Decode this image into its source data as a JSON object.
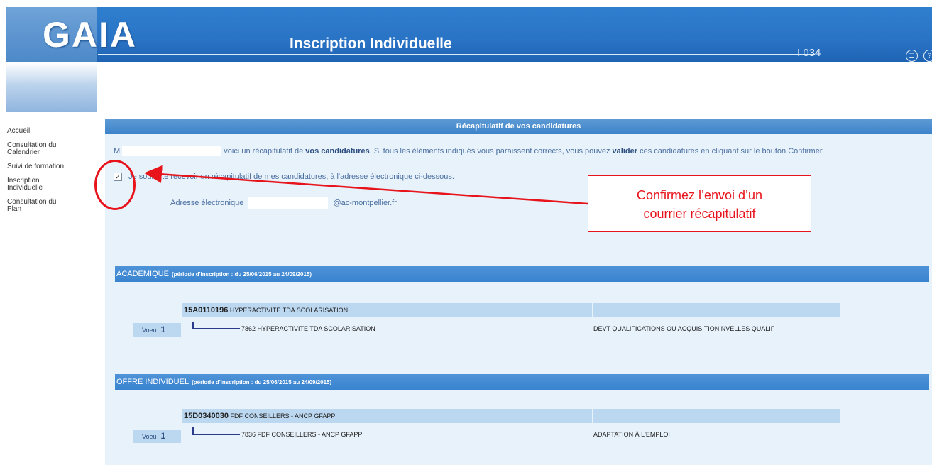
{
  "header": {
    "logo": "GAIA",
    "title": "Inscription Individuelle",
    "code": "I 034"
  },
  "sidebar": {
    "items": [
      {
        "label": "Accueil"
      },
      {
        "label": "Consultation du Calendrier"
      },
      {
        "label": "Suivi de formation"
      },
      {
        "label": "Inscription Individuelle"
      },
      {
        "label": "Consultation du Plan"
      }
    ]
  },
  "main": {
    "recap_title": "Récapitulatif de vos candidatures",
    "intro": {
      "prefix": "M",
      "text1": "voici un récapitulatif de",
      "bold1": "vos candidatures",
      "text2": ". Si tous les éléments indiqués vous paraissent corrects, vous pouvez",
      "bold2": "valider",
      "text3": "ces candidatures en cliquant sur le bouton Confirmer."
    },
    "checkbox_label": "Je souhaite recevoir un récapitulatif de mes candidatures, à l'adresse électronique ci-dessous.",
    "email_label": "Adresse électronique",
    "email_domain": "@ac-montpellier.fr"
  },
  "annotation": {
    "callout_line1": "Confirmez l’envoi d’un",
    "callout_line2": "courrier récapitulatif"
  },
  "sections": [
    {
      "title": "ACADEMIQUE",
      "period": "(période d'inscription : du 25/06/2015 au 24/09/2015)",
      "course_code": "15A0110196",
      "course_name": "HYPERACTIVITE TDA SCOLARISATION",
      "voeu_label": "Voeu",
      "voeu_num": "1",
      "module": "7862 HYPERACTIVITE TDA SCOLARISATION",
      "objective": "DEVT QUALIFICATIONS OU ACQUISITION NVELLES QUALIF"
    },
    {
      "title": "OFFRE INDIVIDUEL",
      "period": "(période d'inscription : du 25/06/2015 au 24/09/2015)",
      "course_code": "15D0340030",
      "course_name": "FDF CONSEILLERS - ANCP GFAPP",
      "voeu_label": "Voeu",
      "voeu_num": "1",
      "module": "7836 FDF CONSEILLERS - ANCP GFAPP",
      "objective": "ADAPTATION À L'EMPLOI"
    }
  ],
  "colors": {
    "header_blue": "#2a73c5",
    "panel_bg": "#e8f2fb",
    "section_blue": "#3983cf",
    "annotation_red": "#e8141b"
  }
}
